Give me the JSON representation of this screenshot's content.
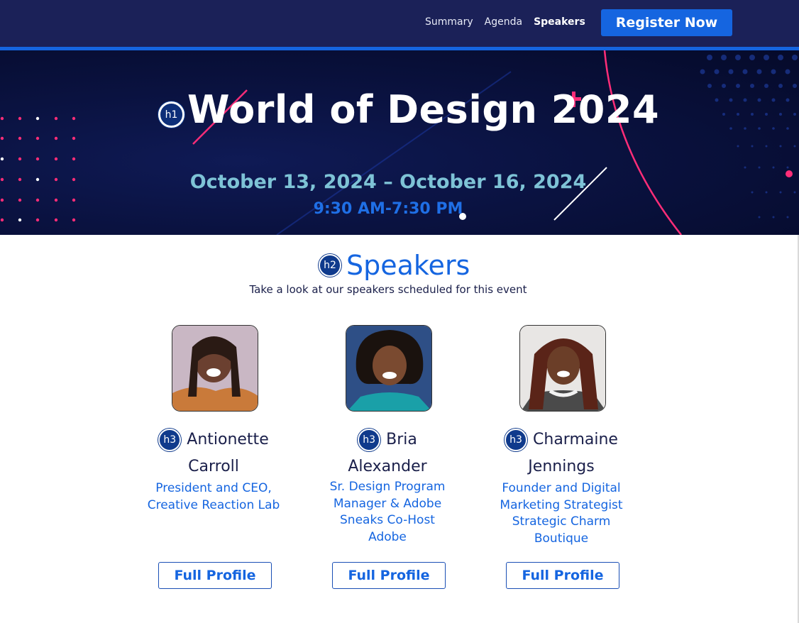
{
  "nav": {
    "links": [
      {
        "label": "Summary"
      },
      {
        "label": "Agenda"
      },
      {
        "label": "Speakers"
      }
    ],
    "register_label": "Register Now"
  },
  "hero": {
    "h1_tag": "h1",
    "title": "World of Design 2024",
    "dates": "October 13, 2024 – October 16, 2024",
    "time": "9:30 AM-7:30 PM"
  },
  "speakers_section": {
    "h2_tag": "h2",
    "title": "Speakers",
    "subtitle": "Take a look at our speakers scheduled for this event",
    "h3_tag": "h3",
    "profile_label": "Full Profile",
    "speakers": [
      {
        "name_first": "Antionette",
        "name_rest": "Carroll",
        "role_lines": [
          "President and CEO,",
          "Creative Reaction Lab"
        ]
      },
      {
        "name_first": "Bria Alexander",
        "name_rest": "",
        "role_lines": [
          "Sr. Design Program",
          "Manager & Adobe",
          "Sneaks Co-Host",
          "Adobe"
        ]
      },
      {
        "name_first": "Charmaine",
        "name_rest": "Jennings",
        "role_lines": [
          "Founder and Digital",
          "Marketing Strategist",
          "Strategic Charm",
          "Boutique"
        ]
      }
    ]
  },
  "colors": {
    "nav_bg": "#1b2158",
    "accent_blue": "#1565e0",
    "hero_bg": "#0a1240",
    "date_teal": "#7ec3d6",
    "accent_pink": "#ff2d78"
  }
}
